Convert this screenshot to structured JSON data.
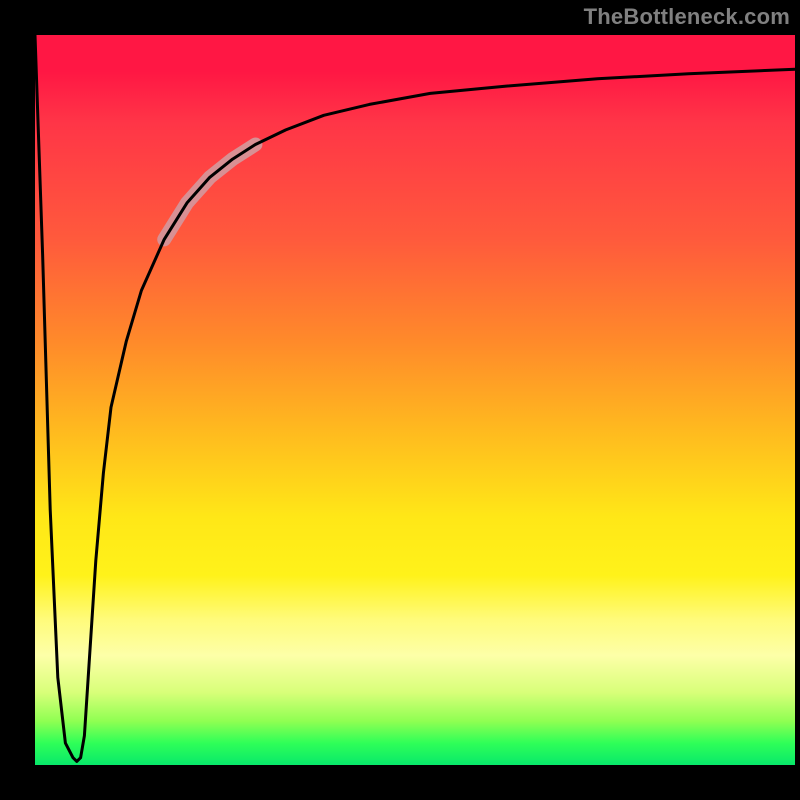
{
  "watermark": "TheBottleneck.com",
  "chart_data": {
    "type": "line",
    "title": "",
    "xlabel": "",
    "ylabel": "",
    "xlim": [
      0,
      100
    ],
    "ylim": [
      0,
      100
    ],
    "series": [
      {
        "name": "curve",
        "x": [
          0,
          1,
          2,
          3,
          4,
          5,
          5.5,
          6,
          6.5,
          7,
          8,
          9,
          10,
          12,
          14,
          17,
          20,
          23,
          26,
          29,
          33,
          38,
          44,
          52,
          62,
          74,
          86,
          100
        ],
        "values": [
          100,
          70,
          35,
          12,
          3,
          1,
          0.5,
          1,
          4,
          12,
          28,
          40,
          49,
          58,
          65,
          72,
          77,
          80.5,
          83,
          85,
          87,
          89,
          90.5,
          92,
          93,
          94,
          94.7,
          95.3
        ]
      },
      {
        "name": "highlight-band",
        "x": [
          17,
          20,
          23,
          26,
          29
        ],
        "values": [
          72,
          77,
          80.5,
          83,
          85
        ]
      }
    ],
    "gradient_stops": [
      {
        "pos": 0,
        "color": "#ff1744"
      },
      {
        "pos": 28,
        "color": "#ff5a3c"
      },
      {
        "pos": 54,
        "color": "#ffb91f"
      },
      {
        "pos": 74,
        "color": "#fff21a"
      },
      {
        "pos": 90,
        "color": "#d9ff7a"
      },
      {
        "pos": 100,
        "color": "#08e86a"
      }
    ]
  }
}
